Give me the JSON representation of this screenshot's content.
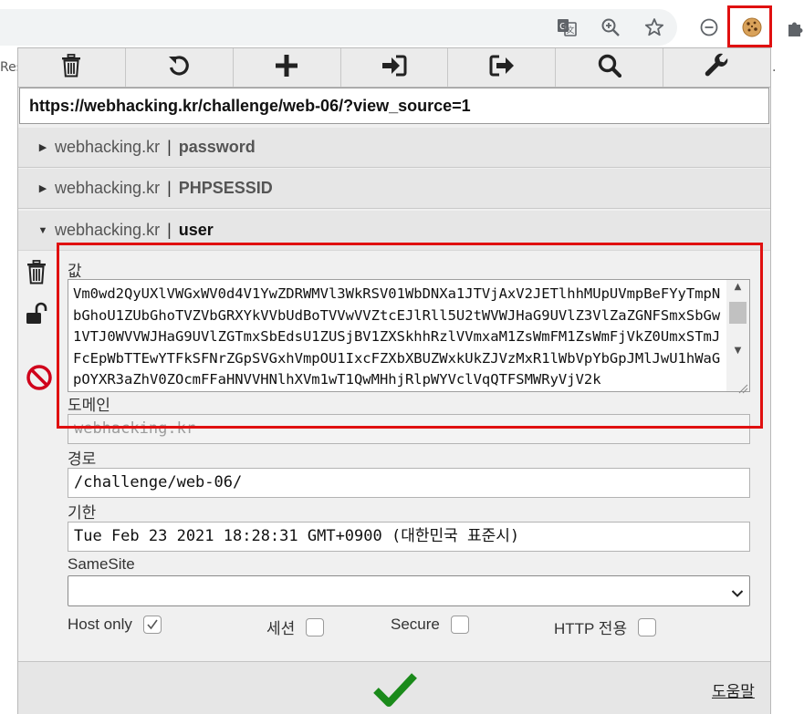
{
  "browser": {
    "icons": [
      "translate-icon",
      "zoom-icon",
      "bookmark-star-icon",
      "minus-circle-icon",
      "cookie-extension-icon",
      "puzzle-extensions-icon"
    ],
    "page_behind_left": "Res",
    "page_behind_right": "."
  },
  "toolbar": {
    "buttons": [
      {
        "name": "delete-all",
        "icon": "trash-icon"
      },
      {
        "name": "refresh",
        "icon": "refresh-icon"
      },
      {
        "name": "add-cookie",
        "icon": "plus-icon"
      },
      {
        "name": "import",
        "icon": "import-icon"
      },
      {
        "name": "export",
        "icon": "export-icon"
      },
      {
        "name": "search",
        "icon": "search-icon"
      },
      {
        "name": "options",
        "icon": "wrench-icon"
      }
    ]
  },
  "url": "https://webhacking.kr/challenge/web-06/?view_source=1",
  "cookies": [
    {
      "domain": "webhacking.kr",
      "separator": "|",
      "name": "password",
      "expanded": false
    },
    {
      "domain": "webhacking.kr",
      "separator": "|",
      "name": "PHPSESSID",
      "expanded": false
    },
    {
      "domain": "webhacking.kr",
      "separator": "|",
      "name": "user",
      "expanded": true
    }
  ],
  "editor": {
    "value_label": "값",
    "value": "Vm0wd2QyUXlVWGxWV0d4V1YwZDRWMVl3WkRSV01WbDNXa1JTVjAxV2JETlhhMUpUVmpBeFYyTmpNbGhoU1ZUbGhoTVZVbGRXYkVVbUdBoTVVwVVZtcEJlRll5U2tWVWJHaG9UVlZ3VlZaZGNFSmxSbGw1VTJ0WVVWJHaG9UVlZGTmxSbEdsU1ZUSjBV1ZXSkhhRzlVVmxaM1ZsWmFM1ZsWmFjVkZ0UmxSTmJFcEpWbTTEwYTFkSFNrZGpSVGxhVmpOU1IxcFZXbXBUZWxkUkZJVzMxR1lWbVpYbGpJMlJwU1hWaGpOYXR3aZhV0ZOcmFFaHNVVHNlhXVm1wT1QwMHhjRlpWYVclVqQTFSMWRyVjV2k",
    "domain_label": "도메인",
    "domain": "webhacking.kr",
    "path_label": "경로",
    "path": "/challenge/web-06/",
    "expires_label": "기한",
    "expires": "Tue Feb 23 2021 18:28:31 GMT+0900 (대한민국 표준시)",
    "samesite_label": "SameSite",
    "samesite": "",
    "hostonly_label": "Host only",
    "hostonly_checked": true,
    "session_label": "세션",
    "session_checked": false,
    "secure_label": "Secure",
    "secure_checked": false,
    "httponly_label": "HTTP 전용",
    "httponly_checked": false,
    "side_icons": [
      "trash-icon",
      "unlock-icon",
      "block-icon"
    ]
  },
  "footer": {
    "save_icon": "checkmark-icon",
    "help_label": "도움말"
  },
  "colors": {
    "highlight": "#e01010",
    "block": "#d0021b",
    "check": "#1a8a1a"
  }
}
